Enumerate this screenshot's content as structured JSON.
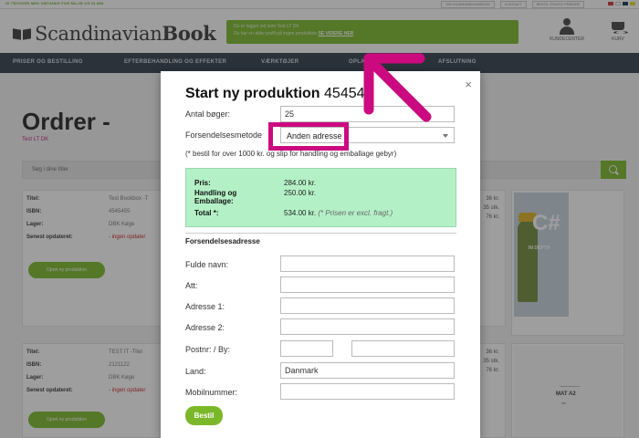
{
  "topbar": {
    "promo": "GI TRYKKER MED OMTANKE FOR MILJØ OG KLIMA",
    "links": [
      "OM SCANDINAVIANBOOK",
      "KONTAKT",
      "BESTIL GRATIS PRØVER"
    ]
  },
  "header": {
    "logo_regular": "Scandinavian",
    "logo_bold": "Book",
    "notice_line1": "Du er logget ind som Test LT DK",
    "notice_line2": "Du har en aktiv profil på ingen produktion",
    "notice_link": "SE VIDERE HER",
    "account_label": "KUNDECENTER",
    "cart_label": "KURV"
  },
  "nav": {
    "items": [
      "PRISER OG BESTILLING",
      "EFTERBEHANDLING OG EFFEKTER",
      "VÆRKTØJER",
      "OPLAGTNING",
      "AFSLUTNING"
    ]
  },
  "page": {
    "title": "Ordrer -",
    "subtitle": "Test LT DK",
    "search_placeholder": "Søg i dine titler"
  },
  "orders": [
    {
      "title_label": "Titel:",
      "title": "Test Bookbox -T",
      "isbn_label": "ISBN:",
      "isbn": "4545455",
      "stock_label": "Lager:",
      "stock": "DBK Køge",
      "updated_label": "Senest opdateret:",
      "updated": "- ingen opdater",
      "right": [
        "36 kr.",
        "35 stk.",
        "76 kr."
      ],
      "button": "Opret ny produktion"
    },
    {
      "title_label": "Titel:",
      "title": "TEST IT -Titel",
      "isbn_label": "ISBN:",
      "isbn": "2121122",
      "stock_label": "Lager:",
      "stock": "DBK Køge",
      "updated_label": "Senest opdateret:",
      "updated": "- ingen opdater",
      "right": [
        "36 kr.",
        "35 stk.",
        "76 kr."
      ],
      "button": "Opret ny produktion"
    }
  ],
  "covers": {
    "book1_letter": "C#",
    "book1_sub": "IN DEPTH",
    "book2_title": "MAT A2",
    "book2_sub": "stx"
  },
  "modal": {
    "close": "×",
    "title": "Start ny produktion",
    "title_number": "454545",
    "qty_label": "Antal bøger:",
    "qty_value": "25",
    "shipping_label": "Forsendelsesmetode",
    "shipping_value": "Anden adresse",
    "note": "(* bestil for over 1000 kr. og slip for handling og emballage gebyr)",
    "price_label": "Pris:",
    "price_value": "284.00 kr.",
    "handling_label1": "Handling og",
    "handling_label2": "Emballage:",
    "handling_value": "250.00 kr.",
    "total_label": "Total *:",
    "total_value": "534.00 kr.",
    "total_note": "(* Prisen er excl. fragt.)",
    "address_section": "Forsendelsesadresse",
    "name_label": "Fulde navn:",
    "att_label": "Att:",
    "addr1_label": "Adresse 1:",
    "addr2_label": "Adresse 2:",
    "zip_label": "Postnr: / By:",
    "country_label": "Land:",
    "country_value": "Danmark",
    "mobile_label": "Mobilnummer:",
    "submit": "Bestil"
  },
  "colors": {
    "accent_green": "#7ab829",
    "nav_dark": "#2e3b49",
    "highlight": "#cc0a7f",
    "price_box": "#b4f0c6"
  }
}
